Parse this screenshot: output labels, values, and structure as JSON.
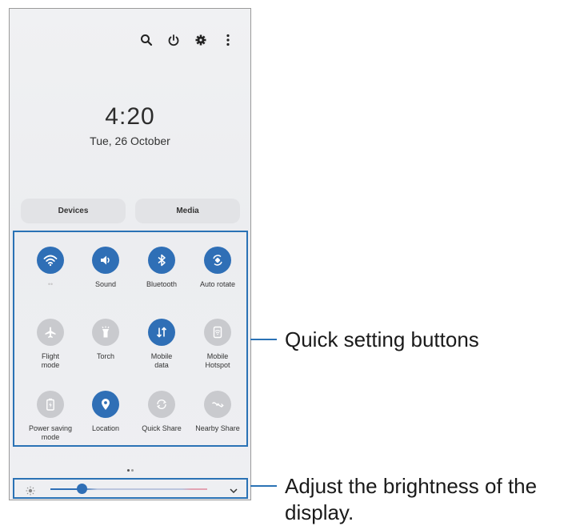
{
  "header": {
    "icons": [
      "search-icon",
      "power-icon",
      "gear-icon",
      "more-options-icon"
    ]
  },
  "clock": {
    "time": "4:20",
    "date": "Tue, 26 October"
  },
  "panel_buttons": {
    "devices": "Devices",
    "media": "Media"
  },
  "quick_settings": {
    "tiles": [
      {
        "label": "",
        "icon": "wifi-icon",
        "active": true
      },
      {
        "label": "Sound",
        "icon": "sound-icon",
        "active": true
      },
      {
        "label": "Bluetooth",
        "icon": "bluetooth-icon",
        "active": true
      },
      {
        "label": "Auto rotate",
        "icon": "auto-rotate-icon",
        "active": true
      },
      {
        "label": "Flight\nmode",
        "icon": "airplane-icon",
        "active": false
      },
      {
        "label": "Torch",
        "icon": "torch-icon",
        "active": false
      },
      {
        "label": "Mobile\ndata",
        "icon": "mobile-data-icon",
        "active": true
      },
      {
        "label": "Mobile\nHotspot",
        "icon": "hotspot-icon",
        "active": false
      },
      {
        "label": "Power saving\nmode",
        "icon": "battery-icon",
        "active": false
      },
      {
        "label": "Location",
        "icon": "location-icon",
        "active": true
      },
      {
        "label": "Quick Share",
        "icon": "quick-share-icon",
        "active": false
      },
      {
        "label": "Nearby Share",
        "icon": "nearby-share-icon",
        "active": false
      }
    ]
  },
  "page_indicator": {
    "pages": 2,
    "current": 1
  },
  "brightness": {
    "level": 0.2
  },
  "callouts": {
    "quick_settings": "Quick setting buttons",
    "brightness": "Adjust the brightness of the display."
  },
  "colors": {
    "accent": "#2f6fb6",
    "callout_line": "#2a72b5",
    "inactive_tile": "#c9cace"
  }
}
